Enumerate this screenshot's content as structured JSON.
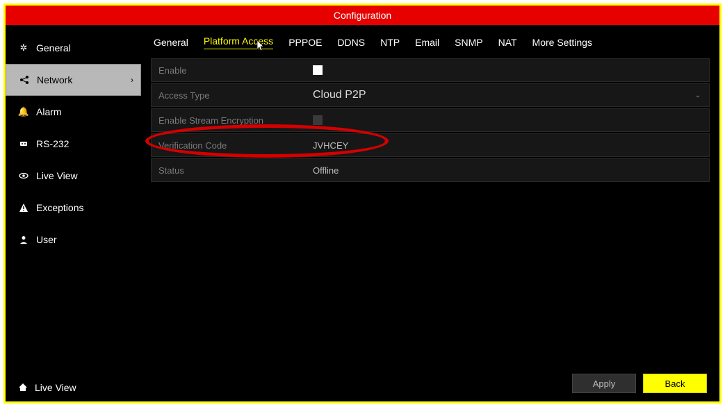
{
  "title": "Configuration",
  "sidebar": {
    "items": [
      {
        "icon": "gear",
        "label": "General"
      },
      {
        "icon": "network",
        "label": "Network",
        "selected": true
      },
      {
        "icon": "bell",
        "label": "Alarm"
      },
      {
        "icon": "plug",
        "label": "RS-232"
      },
      {
        "icon": "eye",
        "label": "Live View"
      },
      {
        "icon": "warn",
        "label": "Exceptions"
      },
      {
        "icon": "user",
        "label": "User"
      }
    ],
    "footer": {
      "icon": "home",
      "label": "Live View"
    }
  },
  "tabs": [
    "General",
    "Platform Access",
    "PPPOE",
    "DDNS",
    "NTP",
    "Email",
    "SNMP",
    "NAT",
    "More Settings"
  ],
  "active_tab_index": 1,
  "form": {
    "enable": {
      "label": "Enable",
      "checked": false
    },
    "access_type": {
      "label": "Access Type",
      "value": "Cloud P2P"
    },
    "stream_encryption": {
      "label": "Enable Stream Encryption",
      "checked": false,
      "disabled": true
    },
    "verification_code": {
      "label": "Verification Code",
      "value": "JVHCEY"
    },
    "status": {
      "label": "Status",
      "value": "Offline"
    }
  },
  "buttons": {
    "apply": "Apply",
    "back": "Back"
  },
  "annotation": {
    "style": "red-ellipse",
    "target": "verification_code"
  }
}
